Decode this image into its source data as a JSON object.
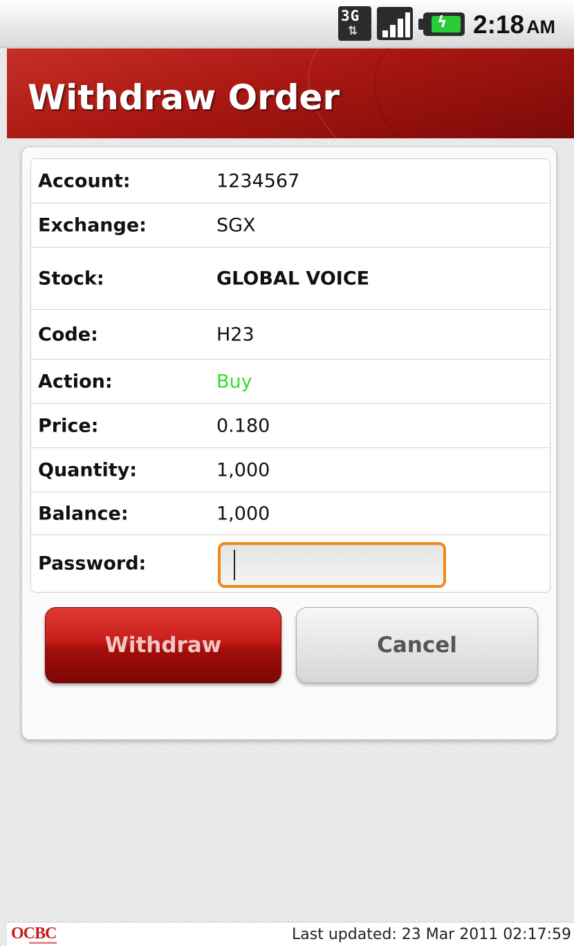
{
  "status_bar": {
    "network": "3G",
    "time": "2:18",
    "ampm": "AM"
  },
  "header": {
    "title": "Withdraw Order"
  },
  "order": {
    "rows": [
      {
        "label": "Account:",
        "value": "1234567"
      },
      {
        "label": "Exchange:",
        "value": "SGX"
      },
      {
        "label": "Stock:",
        "value": "GLOBAL VOICE"
      },
      {
        "label": "Code:",
        "value": "H23"
      },
      {
        "label": "Action:",
        "value": "Buy"
      },
      {
        "label": "Price:",
        "value": "0.180"
      },
      {
        "label": "Quantity:",
        "value": "1,000"
      },
      {
        "label": "Balance:",
        "value": "1,000"
      }
    ],
    "password_label": "Password:",
    "password_value": "",
    "action_color": "#33dd33"
  },
  "buttons": {
    "withdraw": "Withdraw",
    "cancel": "Cancel"
  },
  "footer": {
    "logo": "OCBC",
    "last_updated": "Last updated: 23 Mar 2011 02:17:59"
  },
  "colors": {
    "brand_red": "#a81712",
    "focus_orange": "#f0881c"
  }
}
